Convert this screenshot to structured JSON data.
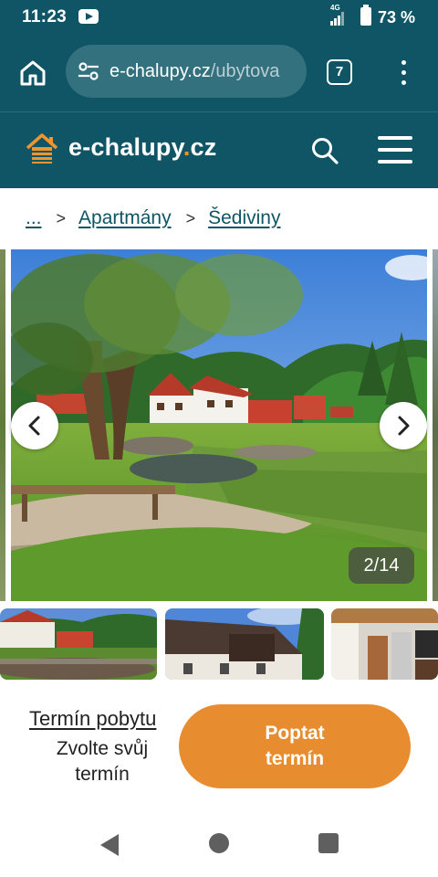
{
  "status_bar": {
    "time": "11:23",
    "network": "4G",
    "battery": "73 %"
  },
  "browser": {
    "url_domain": "e-chalupy.cz",
    "url_path": "/ubytova",
    "tab_count": "7"
  },
  "site_header": {
    "logo_prefix": "e-chalupy",
    "logo_dot": ".",
    "logo_suffix": "cz"
  },
  "breadcrumb": {
    "items": [
      "...",
      "Apartmány",
      "Šediviny"
    ],
    "separator": ">"
  },
  "gallery": {
    "counter": "2/14",
    "current": 2,
    "total": 14,
    "thumbnails": [
      "thumb-pond-houses",
      "thumb-house-roof",
      "thumb-kitchen"
    ]
  },
  "booking": {
    "term_title": "Termín pobytu",
    "term_hint": "Zvolte svůj termín",
    "cta_label": "Poptat termín"
  },
  "icons": {
    "home": "home-icon",
    "site_settings": "tune-icon",
    "tabs": "tabs-icon",
    "menu": "more-vert-icon",
    "search": "search-icon",
    "hamburger": "menu-icon",
    "prev": "chevron-left-icon",
    "next": "chevron-right-icon"
  },
  "colors": {
    "brand_teal": "#0f5566",
    "accent_orange": "#e88d2f",
    "url_box": "#33717f"
  }
}
